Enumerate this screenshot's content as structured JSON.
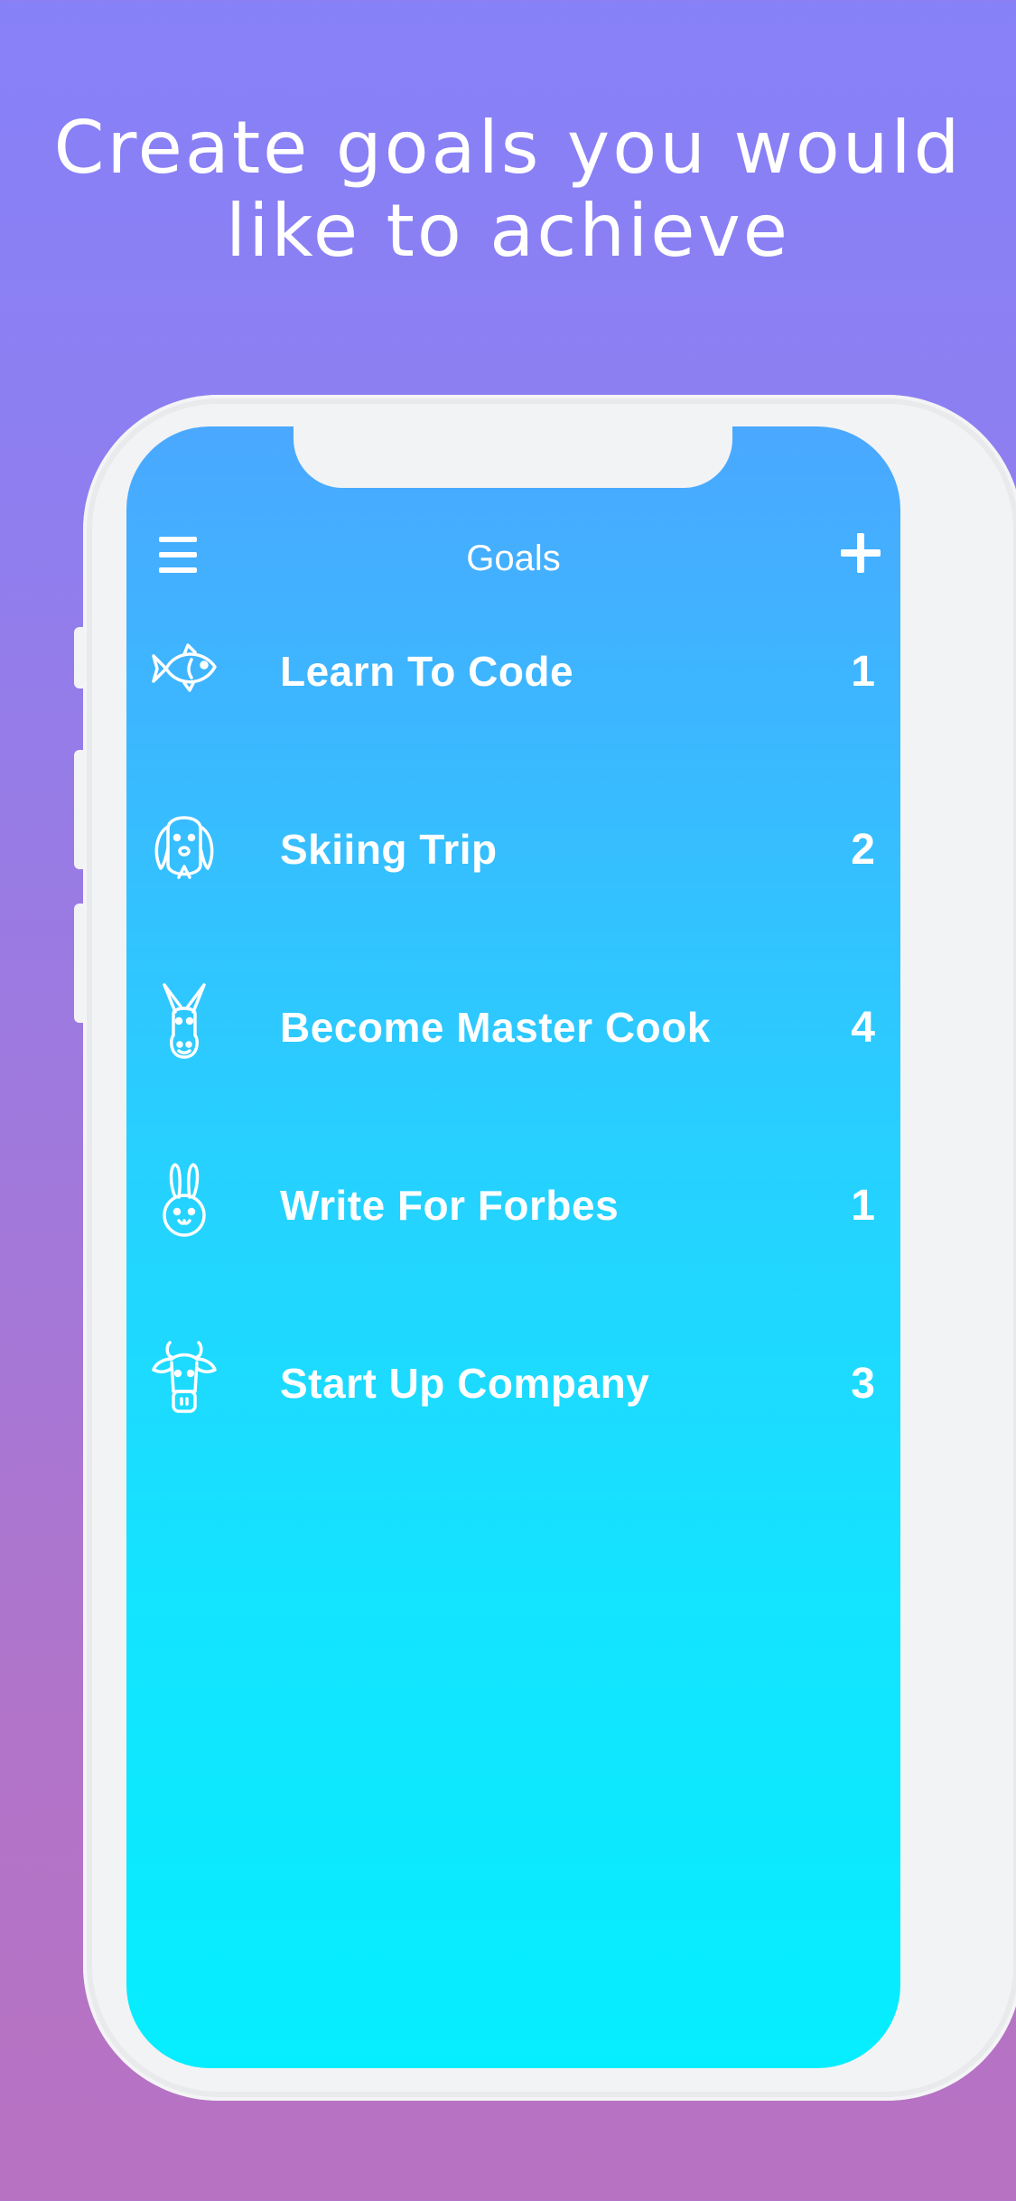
{
  "headline": {
    "line1": "Create goals you would",
    "line2": "like to achieve"
  },
  "nav": {
    "title": "Goals",
    "menu_icon": "hamburger-menu-icon",
    "add_icon": "plus-icon"
  },
  "goals": [
    {
      "icon": "fish-icon",
      "label": "Learn To Code",
      "count": "1"
    },
    {
      "icon": "dog-icon",
      "label": "Skiing Trip",
      "count": "2"
    },
    {
      "icon": "donkey-icon",
      "label": "Become Master Cook",
      "count": "4"
    },
    {
      "icon": "rabbit-icon",
      "label": "Write For Forbes",
      "count": "1"
    },
    {
      "icon": "cow-icon",
      "label": "Start Up Company",
      "count": "3"
    }
  ],
  "colors": {
    "background_top": "#8781f8",
    "background_bottom": "#b872c2",
    "screen_top": "#4aa8ff",
    "screen_bottom": "#05eeff",
    "text": "#ffffff"
  }
}
